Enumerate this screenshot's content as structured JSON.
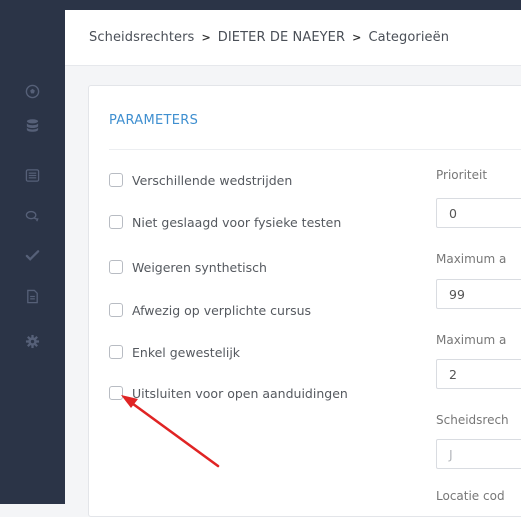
{
  "breadcrumb": {
    "items": [
      "Scheidsrechters",
      "DIETER DE NAEYER",
      "Categorieën"
    ],
    "separator": ">"
  },
  "sidebar": {
    "icons": [
      "soccer-ball-icon",
      "database-icon",
      "list-icon",
      "chat-icon",
      "check-icon",
      "document-icon",
      "gear-icon"
    ]
  },
  "card": {
    "title": "PARAMETERS"
  },
  "checkboxes": [
    {
      "label": "Verschillende wedstrijden",
      "checked": false
    },
    {
      "label": "Niet geslaagd voor fysieke testen",
      "checked": false
    },
    {
      "label": "Weigeren synthetisch",
      "checked": false
    },
    {
      "label": "Afwezig op verplichte cursus",
      "checked": false
    },
    {
      "label": "Enkel gewestelijk",
      "checked": false
    },
    {
      "label": "Uitsluiten voor open aanduidingen",
      "checked": false
    }
  ],
  "fields": [
    {
      "label": "Prioriteit",
      "value": "0",
      "placeholder": ""
    },
    {
      "label": "Maximum a",
      "value": "99",
      "placeholder": ""
    },
    {
      "label": "Maximum a",
      "value": "2",
      "placeholder": ""
    },
    {
      "label": "Scheidsrech",
      "value": "",
      "placeholder": "J"
    },
    {
      "label": "Locatie cod",
      "value": "",
      "placeholder": ""
    }
  ],
  "colors": {
    "sidebar": "#2b3447",
    "accent": "#3f8fd0",
    "annotation_arrow": "#e02424"
  }
}
